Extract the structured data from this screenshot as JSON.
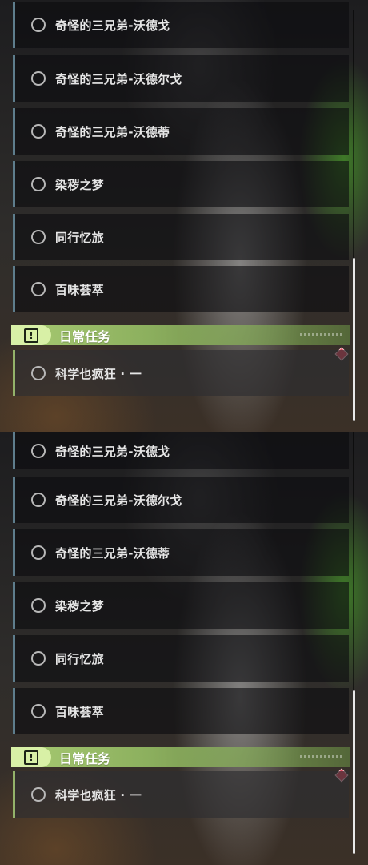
{
  "panels": [
    {
      "quests": [
        {
          "label": "奇怪的三兄弟-沃德戈"
        },
        {
          "label": "奇怪的三兄弟-沃德尔戈"
        },
        {
          "label": "奇怪的三兄弟-沃德蒂"
        },
        {
          "label": "染秽之梦"
        },
        {
          "label": "同行忆旅"
        },
        {
          "label": "百味荟萃"
        }
      ],
      "daily_section": {
        "title": "日常任务",
        "icon": "exclamation-icon",
        "items": [
          {
            "label": "科学也疯狂 · 一"
          }
        ]
      }
    },
    {
      "quests": [
        {
          "label": "奇怪的三兄弟-沃德戈"
        },
        {
          "label": "奇怪的三兄弟-沃德尔戈"
        },
        {
          "label": "奇怪的三兄弟-沃德蒂"
        },
        {
          "label": "染秽之梦"
        },
        {
          "label": "同行忆旅"
        },
        {
          "label": "百味荟萃"
        }
      ],
      "daily_section": {
        "title": "日常任务",
        "icon": "exclamation-icon",
        "items": [
          {
            "label": "科学也疯狂 · 一"
          }
        ]
      }
    }
  ],
  "colors": {
    "quest_accent": "#5e7d8c",
    "daily_accent": "#93b26a",
    "badge": "#e0455a"
  }
}
